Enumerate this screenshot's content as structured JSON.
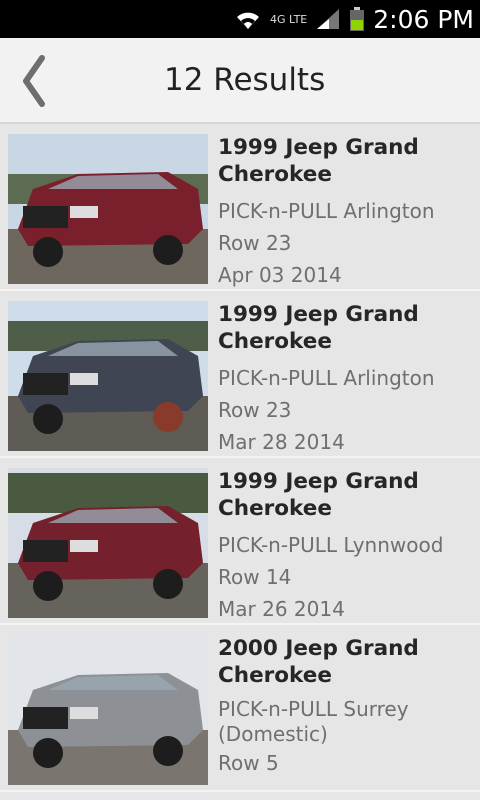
{
  "status": {
    "time": "2:06 PM",
    "network": "4G LTE"
  },
  "header": {
    "title": "12 Results"
  },
  "results": [
    {
      "title": "1999 Jeep Grand Cherokee",
      "location": "PICK-n-PULL Arlington",
      "row": "Row 23",
      "date": "Apr 03 2014",
      "color": "#7a1f2c"
    },
    {
      "title": "1999 Jeep Grand Cherokee",
      "location": "PICK-n-PULL Arlington",
      "row": "Row 23",
      "date": "Mar 28 2014",
      "color": "#3f4552"
    },
    {
      "title": "1999 Jeep Grand Cherokee",
      "location": "PICK-n-PULL Lynnwood",
      "row": "Row 14",
      "date": "Mar 26 2014",
      "color": "#74202d"
    },
    {
      "title": "2000 Jeep Grand Cherokee",
      "location": "PICK-n-PULL Surrey (Domestic)",
      "row": "Row 5",
      "date": "",
      "color": "#8d9095"
    }
  ]
}
